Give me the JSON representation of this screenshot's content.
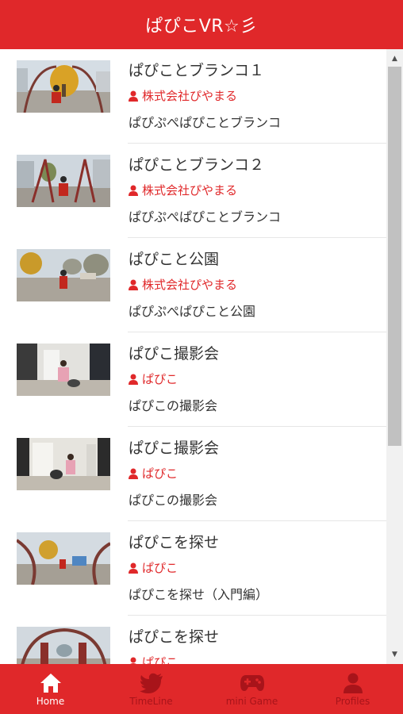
{
  "header": {
    "title": "ぱぴこVR☆彡"
  },
  "videos": [
    {
      "title": "ぱぴことブランコ１",
      "author": "株式会社ぴやまる",
      "description": "ぱぴぷぺぱぴことブランコ"
    },
    {
      "title": "ぱぴことブランコ２",
      "author": "株式会社ぴやまる",
      "description": "ぱぴぷぺぱぴことブランコ"
    },
    {
      "title": "ぱぴこと公園",
      "author": "株式会社ぴやまる",
      "description": "ぱぴぷぺぱぴこと公園"
    },
    {
      "title": "ぱぴこ撮影会",
      "author": "ぱぴこ",
      "description": "ぱぴこの撮影会"
    },
    {
      "title": "ぱぴこ撮影会",
      "author": "ぱぴこ",
      "description": "ぱぴこの撮影会"
    },
    {
      "title": "ぱぴこを探せ",
      "author": "ぱぴこ",
      "description": "ぱぴこを探せ（入門編）"
    },
    {
      "title": "ぱぴこを探せ",
      "author": "ぱぴこ",
      "description": ""
    }
  ],
  "nav": [
    {
      "label": "Home",
      "icon": "home-icon",
      "active": true
    },
    {
      "label": "TimeLine",
      "icon": "twitter-bird-icon",
      "active": false
    },
    {
      "label": "mini Game",
      "icon": "gamepad-icon",
      "active": false
    },
    {
      "label": "Profiles",
      "icon": "person-icon",
      "active": false
    }
  ],
  "colors": {
    "accent": "#e0282a",
    "nav_inactive": "#a8141a",
    "text": "#333333"
  }
}
